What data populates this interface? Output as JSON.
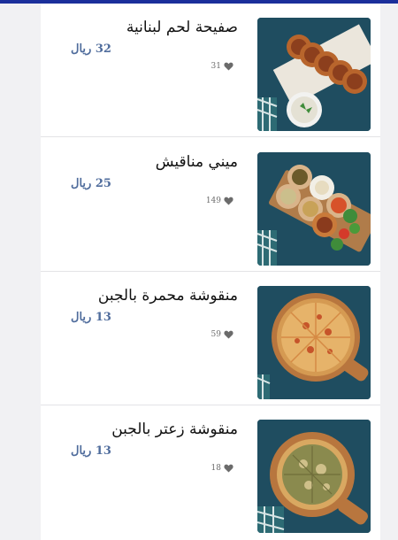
{
  "colors": {
    "accent": "#1b2f9b",
    "price": "#4f6c9c",
    "heart": "#6b6b6b"
  },
  "menu": {
    "items": [
      {
        "name": "صفيحة لحم لبنانية",
        "price": "32 ريال",
        "likes": "31",
        "icon": "heart-icon"
      },
      {
        "name": "ميني مناقيش",
        "price": "25 ريال",
        "likes": "149",
        "icon": "heart-icon"
      },
      {
        "name": "منقوشة محمرة بالجبن",
        "price": "13 ريال",
        "likes": "59",
        "icon": "heart-icon"
      },
      {
        "name": "منقوشة زعتر بالجبن",
        "price": "13 ريال",
        "likes": "18",
        "icon": "heart-icon"
      }
    ]
  }
}
